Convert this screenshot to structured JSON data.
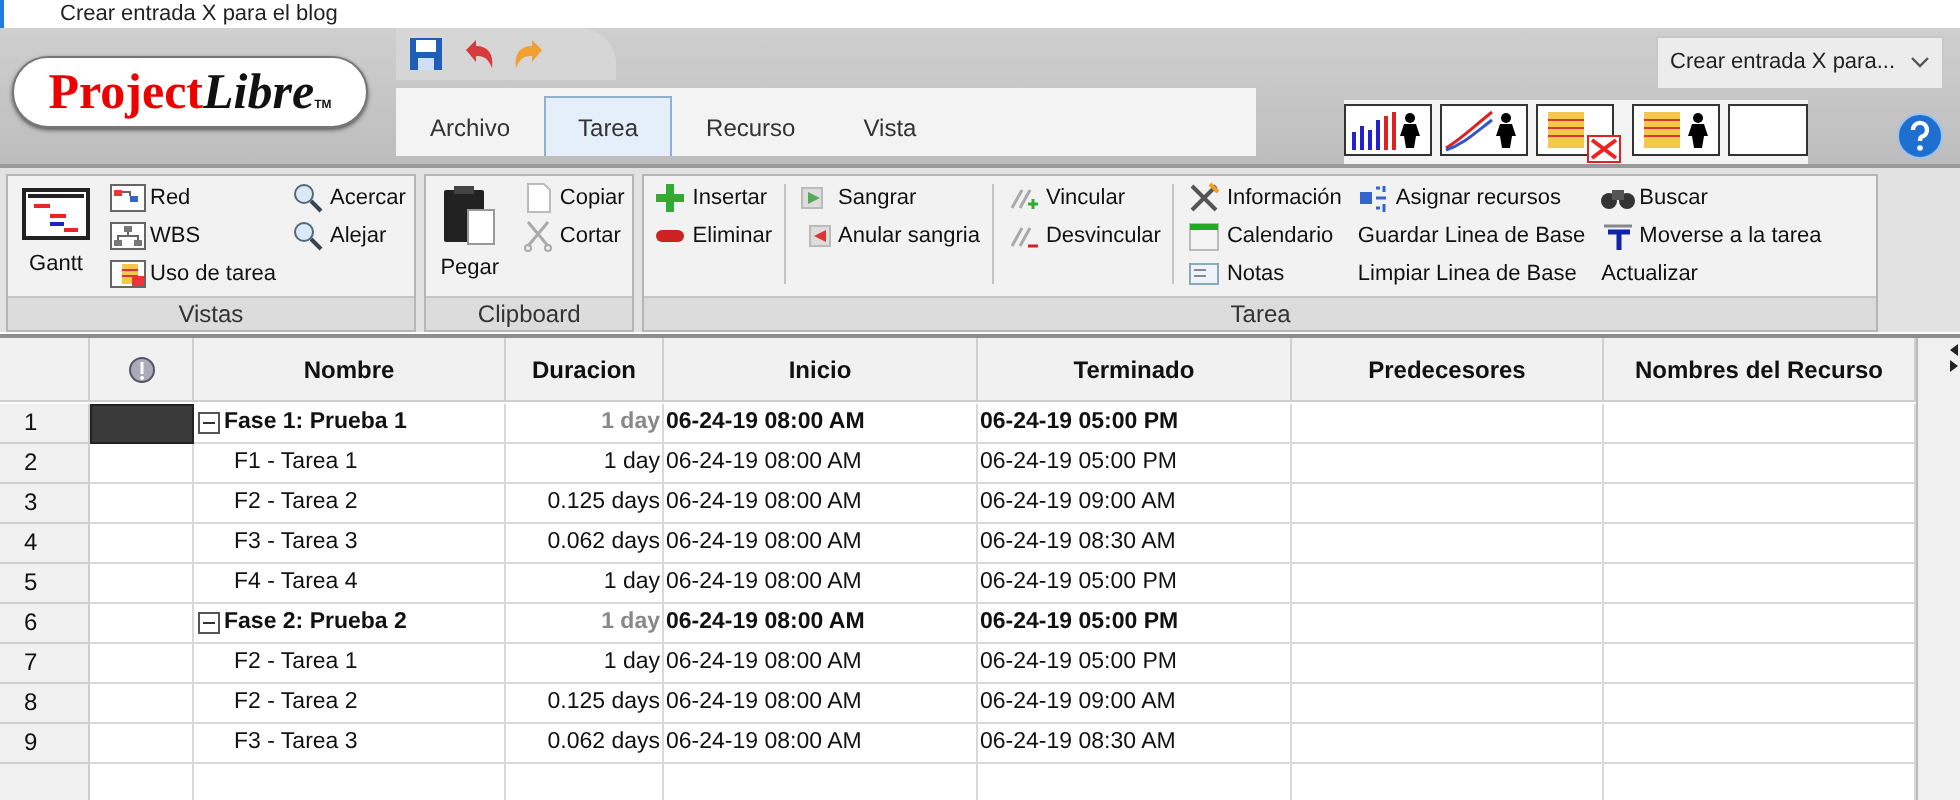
{
  "window": {
    "title": "Crear entrada X para el blog"
  },
  "logo": {
    "first": "Project",
    "second": "Libre",
    "mark": "TM"
  },
  "project_selector": {
    "value": "Crear entrada X para..."
  },
  "menu_tabs": [
    {
      "label": "Archivo",
      "selected": false
    },
    {
      "label": "Tarea",
      "selected": true
    },
    {
      "label": "Recurso",
      "selected": false
    },
    {
      "label": "Vista",
      "selected": false
    }
  ],
  "ribbon": [
    {
      "label": "Vistas",
      "columns": [
        {
          "items": [
            {
              "label": "Gantt",
              "kind": "large"
            }
          ]
        },
        {
          "items": [
            {
              "label": "Red",
              "kind": "small"
            },
            {
              "label": "WBS",
              "kind": "small"
            },
            {
              "label": "Uso de tarea",
              "kind": "small"
            }
          ]
        },
        {
          "items": [
            {
              "label": "Acercar",
              "kind": "small"
            },
            {
              "label": "Alejar",
              "kind": "small"
            }
          ]
        }
      ]
    },
    {
      "label": "Clipboard",
      "columns": [
        {
          "items": [
            {
              "label": "Pegar",
              "kind": "large"
            }
          ]
        },
        {
          "items": [
            {
              "label": "Copiar",
              "kind": "small"
            },
            {
              "label": "Cortar",
              "kind": "small"
            }
          ]
        }
      ]
    },
    {
      "label": "Tarea",
      "columns": [
        {
          "items": [
            {
              "label": "Insertar",
              "kind": "small"
            },
            {
              "label": "Eliminar",
              "kind": "small"
            }
          ],
          "separator_after": true
        },
        {
          "items": [
            {
              "label": "Sangrar",
              "kind": "small"
            },
            {
              "label": "Anular sangria",
              "kind": "small"
            }
          ],
          "separator_after": true
        },
        {
          "items": [
            {
              "label": "Vincular",
              "kind": "small"
            },
            {
              "label": "Desvincular",
              "kind": "small"
            }
          ],
          "separator_after": true
        },
        {
          "items": [
            {
              "label": "Información",
              "kind": "small"
            },
            {
              "label": "Calendario",
              "kind": "small"
            },
            {
              "label": "Notas",
              "kind": "small"
            }
          ]
        },
        {
          "items": [
            {
              "label": "Asignar recursos",
              "kind": "small"
            },
            {
              "label": "Guardar Linea de Base",
              "kind": "text"
            },
            {
              "label": "Limpiar Linea de Base",
              "kind": "text"
            }
          ]
        },
        {
          "items": [
            {
              "label": "Buscar",
              "kind": "small"
            },
            {
              "label": "Moverse a la tarea",
              "kind": "small"
            },
            {
              "label": "Actualizar",
              "kind": "text"
            }
          ]
        }
      ]
    }
  ],
  "table": {
    "columns": [
      "Nombre",
      "Duracion",
      "Inicio",
      "Terminado",
      "Predecesores",
      "Nombres del Recurso"
    ],
    "rows": [
      {
        "number": "1",
        "kind": "summary",
        "expanded": true,
        "selected": true,
        "name": "Fase 1: Prueba 1",
        "duration": "1 day",
        "start": "06-24-19 08:00 AM",
        "finish": "06-24-19 05:00 PM"
      },
      {
        "number": "2",
        "kind": "task",
        "selected": false,
        "name": "F1 - Tarea 1",
        "duration": "1 day",
        "start": "06-24-19 08:00 AM",
        "finish": "06-24-19 05:00 PM"
      },
      {
        "number": "3",
        "kind": "task",
        "selected": false,
        "name": "F2 - Tarea 2",
        "duration": "0.125 days",
        "start": "06-24-19 08:00 AM",
        "finish": "06-24-19 09:00 AM"
      },
      {
        "number": "4",
        "kind": "task",
        "selected": false,
        "name": "F3 - Tarea 3",
        "duration": "0.062 days",
        "start": "06-24-19 08:00 AM",
        "finish": "06-24-19 08:30 AM"
      },
      {
        "number": "5",
        "kind": "task",
        "selected": false,
        "name": "F4 - Tarea 4",
        "duration": "1 day",
        "start": "06-24-19 08:00 AM",
        "finish": "06-24-19 05:00 PM"
      },
      {
        "number": "6",
        "kind": "summary",
        "expanded": true,
        "selected": false,
        "name": "Fase 2: Prueba 2",
        "duration": "1 day",
        "start": "06-24-19 08:00 AM",
        "finish": "06-24-19 05:00 PM"
      },
      {
        "number": "7",
        "kind": "task",
        "selected": false,
        "name": "F2 - Tarea 1",
        "duration": "1 day",
        "start": "06-24-19 08:00 AM",
        "finish": "06-24-19 05:00 PM"
      },
      {
        "number": "8",
        "kind": "task",
        "selected": false,
        "name": "F2 - Tarea 2",
        "duration": "0.125 days",
        "start": "06-24-19 08:00 AM",
        "finish": "06-24-19 09:00 AM"
      },
      {
        "number": "9",
        "kind": "task",
        "selected": false,
        "name": "F3 - Tarea 3",
        "duration": "0.062 days",
        "start": "06-24-19 08:00 AM",
        "finish": "06-24-19 08:30 AM"
      }
    ]
  }
}
